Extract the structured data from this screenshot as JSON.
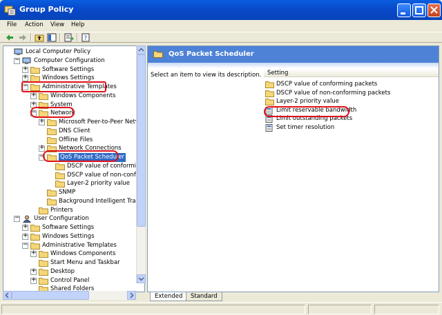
{
  "window": {
    "title": "Group Policy",
    "title_icon": "group-policy-app-icon",
    "buttons": [
      "minimize",
      "maximize",
      "close"
    ]
  },
  "menu": [
    "File",
    "Action",
    "View",
    "Help"
  ],
  "toolbar": {
    "icons": [
      "back-arrow-icon",
      "forward-arrow-icon",
      "up-folder-icon",
      "show-hide-tree-icon",
      "export-list-icon",
      "help-icon"
    ]
  },
  "tree": {
    "items": [
      {
        "label": "Local Computer Policy",
        "level": 0,
        "expander": "",
        "icon": "computer-policy-icon"
      },
      {
        "label": "Computer Configuration",
        "level": 1,
        "expander": "-",
        "icon": "computer-icon"
      },
      {
        "label": "Software Settings",
        "level": 2,
        "expander": "+",
        "icon": "folder-icon"
      },
      {
        "label": "Windows Settings",
        "level": 2,
        "expander": "+",
        "icon": "folder-icon"
      },
      {
        "label": "Administrative Templates",
        "level": 2,
        "expander": "-",
        "icon": "folder-icon"
      },
      {
        "label": "Windows Components",
        "level": 3,
        "expander": "+",
        "icon": "folder-icon"
      },
      {
        "label": "System",
        "level": 3,
        "expander": "+",
        "icon": "folder-icon"
      },
      {
        "label": "Network",
        "level": 3,
        "expander": "-",
        "icon": "folder-open-icon"
      },
      {
        "label": "Microsoft Peer-to-Peer Netwo",
        "level": 4,
        "expander": "+",
        "icon": "folder-icon"
      },
      {
        "label": "DNS Client",
        "level": 4,
        "expander": "",
        "icon": "folder-icon"
      },
      {
        "label": "Offline Files",
        "level": 4,
        "expander": "",
        "icon": "folder-icon"
      },
      {
        "label": "Network Connections",
        "level": 4,
        "expander": "+",
        "icon": "folder-icon"
      },
      {
        "label": "QoS Packet Scheduler",
        "level": 4,
        "expander": "-",
        "icon": "folder-open-icon",
        "selected": true
      },
      {
        "label": "DSCP value of conforming",
        "level": 5,
        "expander": "",
        "icon": "folder-icon"
      },
      {
        "label": "DSCP value of non-confor",
        "level": 5,
        "expander": "",
        "icon": "folder-icon"
      },
      {
        "label": "Layer-2 priority value",
        "level": 5,
        "expander": "",
        "icon": "folder-icon"
      },
      {
        "label": "SNMP",
        "level": 4,
        "expander": "",
        "icon": "folder-icon"
      },
      {
        "label": "Background Intelligent Transf",
        "level": 4,
        "expander": "",
        "icon": "folder-icon"
      },
      {
        "label": "Printers",
        "level": 3,
        "expander": "",
        "icon": "folder-icon"
      },
      {
        "label": "User Configuration",
        "level": 1,
        "expander": "-",
        "icon": "user-icon"
      },
      {
        "label": "Software Settings",
        "level": 2,
        "expander": "+",
        "icon": "folder-icon"
      },
      {
        "label": "Windows Settings",
        "level": 2,
        "expander": "+",
        "icon": "folder-icon"
      },
      {
        "label": "Administrative Templates",
        "level": 2,
        "expander": "-",
        "icon": "folder-icon"
      },
      {
        "label": "Windows Components",
        "level": 3,
        "expander": "+",
        "icon": "folder-icon"
      },
      {
        "label": "Start Menu and Taskbar",
        "level": 3,
        "expander": "",
        "icon": "folder-icon"
      },
      {
        "label": "Desktop",
        "level": 3,
        "expander": "+",
        "icon": "folder-icon"
      },
      {
        "label": "Control Panel",
        "level": 3,
        "expander": "+",
        "icon": "folder-icon"
      },
      {
        "label": "Shared Folders",
        "level": 3,
        "expander": "",
        "icon": "folder-icon"
      }
    ]
  },
  "right_pane": {
    "header": "QoS Packet Scheduler",
    "description": "Select an item to view its description.",
    "column_header": "Setting",
    "items": [
      {
        "label": "DSCP value of conforming packets",
        "icon": "folder-icon"
      },
      {
        "label": "DSCP value of non-conforming packets",
        "icon": "folder-icon"
      },
      {
        "label": "Layer-2 priority value",
        "icon": "folder-icon"
      },
      {
        "label": "Limit reservable bandwidth",
        "icon": "policy-setting-icon"
      },
      {
        "label": "Limit outstanding packets",
        "icon": "policy-setting-icon"
      },
      {
        "label": "Set timer resolution",
        "icon": "policy-setting-icon"
      }
    ]
  },
  "tabs": [
    "Extended",
    "Standard"
  ],
  "colors": {
    "titlebar": "#0a5ee0",
    "header_blue": "#4d82d6",
    "selection": "#316ac5",
    "annotation_red": "#e0101a",
    "folder_yellow": "#f5d77a"
  }
}
